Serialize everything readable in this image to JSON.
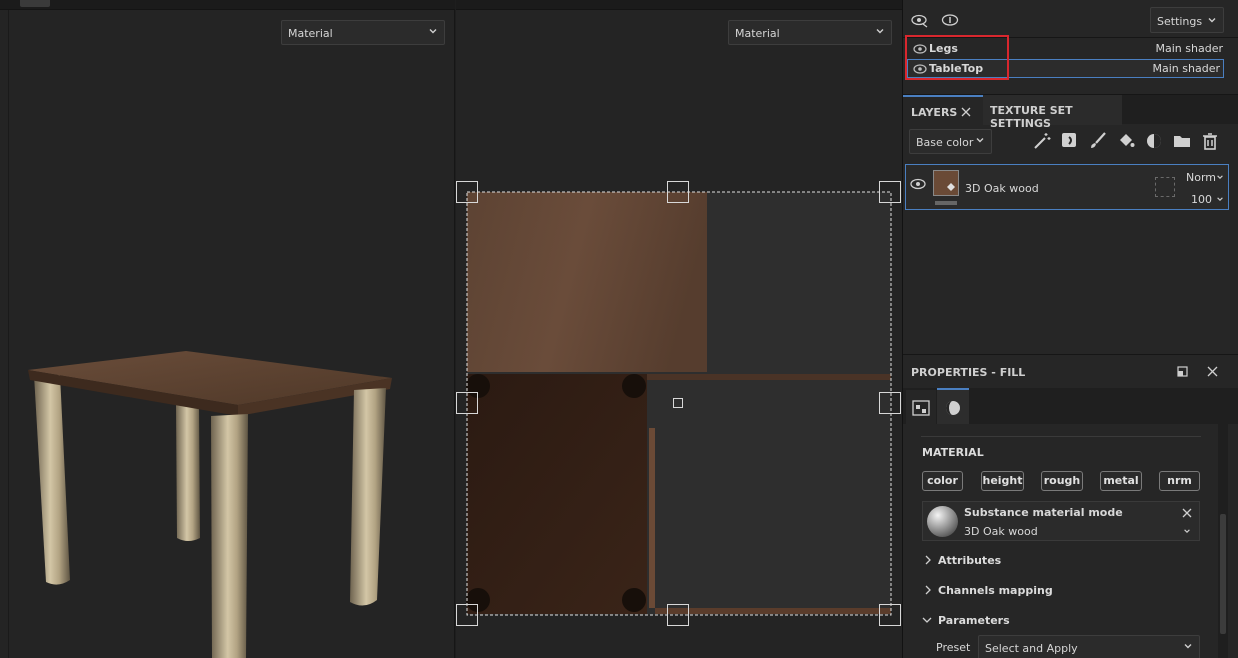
{
  "viewport_3d": {
    "mode_dropdown": "Material"
  },
  "viewport_2d": {
    "mode_dropdown": "Material"
  },
  "texture_sets_panel": {
    "settings_label": "Settings",
    "sets": [
      {
        "name": "Legs",
        "shader": "Main shader"
      },
      {
        "name": "TableTop",
        "shader": "Main shader"
      }
    ]
  },
  "layers_panel": {
    "tabs": [
      {
        "label": "LAYERS"
      },
      {
        "label": "TEXTURE SET SETTINGS"
      }
    ],
    "channel_dropdown": "Base color",
    "layers": [
      {
        "name": "3D Oak wood",
        "blend": "Norm",
        "opacity": "100"
      }
    ]
  },
  "properties": {
    "title": "PROPERTIES - FILL",
    "material_heading": "MATERIAL",
    "channels": [
      "color",
      "height",
      "rough",
      "metal",
      "nrm"
    ],
    "mode_title": "Substance material mode",
    "mode_material": "3D Oak wood",
    "sections": {
      "attributes": "Attributes",
      "channels_mapping": "Channels mapping",
      "parameters": "Parameters"
    },
    "preset_label": "Preset",
    "preset_value": "Select and Apply"
  },
  "colors": {
    "highlight_box": "#d9272e",
    "selection_border": "#4a7fc1",
    "wood": "#5c4232",
    "legs": "#b7a888"
  }
}
